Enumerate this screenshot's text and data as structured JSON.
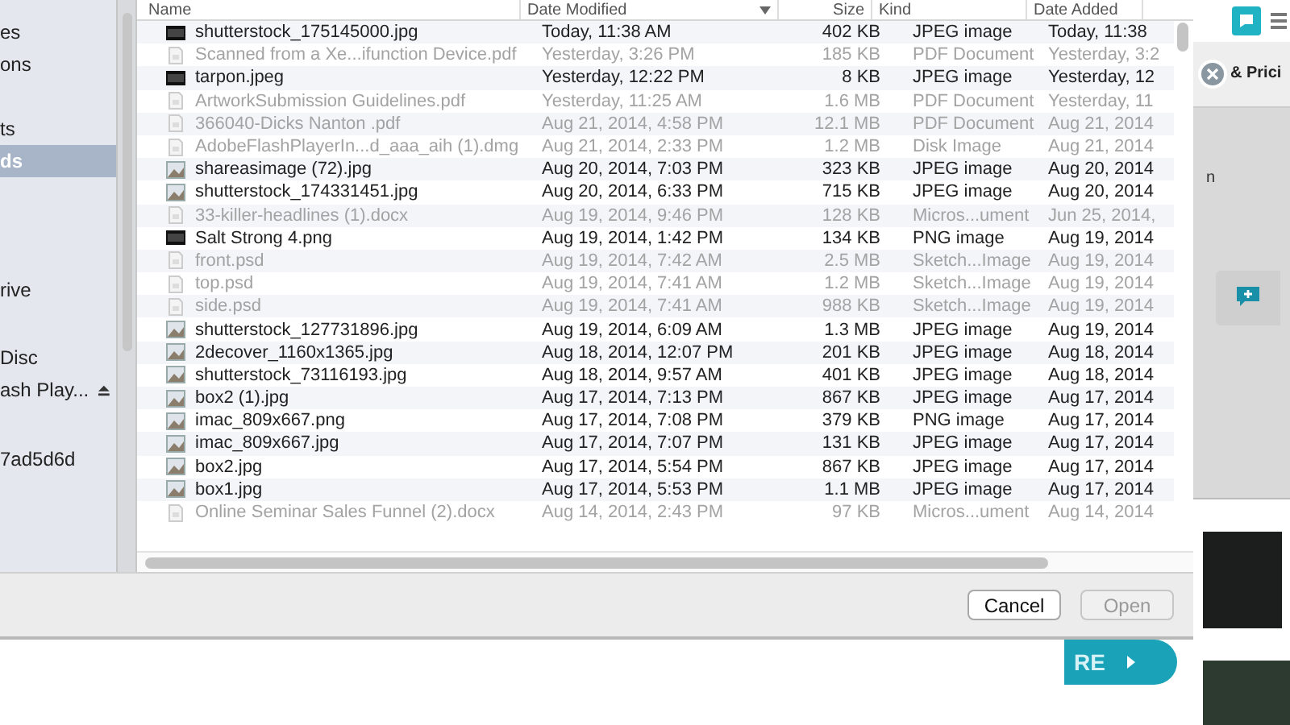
{
  "sidebar": {
    "groups": [
      {
        "items": [
          {
            "label": "es",
            "selected": false
          },
          {
            "label": "ons",
            "selected": false
          }
        ]
      },
      {
        "items": [
          {
            "label": "ts",
            "selected": false
          },
          {
            "label": "ds",
            "selected": true
          }
        ]
      },
      {
        "items": [
          {
            "label": "rive",
            "selected": false
          }
        ]
      },
      {
        "items": [
          {
            "label": "Disc",
            "selected": false
          },
          {
            "label": "ash Play...",
            "selected": false,
            "eject": true
          }
        ]
      },
      {
        "items": [
          {
            "label": "7ad5d6d",
            "selected": false
          }
        ]
      }
    ]
  },
  "file_list": {
    "columns": [
      {
        "label": "Name"
      },
      {
        "label": "Date Modified",
        "sorted": true
      },
      {
        "label": "Size"
      },
      {
        "label": "Kind"
      },
      {
        "label": "Date Added"
      }
    ],
    "rows": [
      {
        "kind": "screenshot",
        "name": "shutterstock_175145000.jpg",
        "modified": "Today, 11:38 AM",
        "size": "402 KB",
        "file_type": "JPEG image",
        "added": "Today, 11:38",
        "enabled": true
      },
      {
        "kind": "document",
        "name": "Scanned from a Xe...ifunction Device.pdf",
        "modified": "Yesterday, 3:26 PM",
        "size": "185 KB",
        "file_type": "PDF Document",
        "added": "Yesterday, 3:2",
        "enabled": false
      },
      {
        "kind": "screenshot",
        "name": "tarpon.jpeg",
        "modified": "Yesterday, 12:22 PM",
        "size": "8 KB",
        "file_type": "JPEG image",
        "added": "Yesterday, 12",
        "enabled": true
      },
      {
        "kind": "document",
        "name": "ArtworkSubmission Guidelines.pdf",
        "modified": "Yesterday, 11:25 AM",
        "size": "1.6 MB",
        "file_type": "PDF Document",
        "added": "Yesterday, 11",
        "enabled": false
      },
      {
        "kind": "document",
        "name": "366040-Dicks  Nanton .pdf",
        "modified": "Aug 21, 2014, 4:58 PM",
        "size": "12.1 MB",
        "file_type": "PDF Document",
        "added": "Aug 21, 2014",
        "enabled": false
      },
      {
        "kind": "document",
        "name": "AdobeFlashPlayerIn...d_aaa_aih (1).dmg",
        "modified": "Aug 21, 2014, 2:33 PM",
        "size": "1.2 MB",
        "file_type": "Disk Image",
        "added": "Aug 21, 2014",
        "enabled": false
      },
      {
        "kind": "photo",
        "name": "shareasimage (72).jpg",
        "modified": "Aug 20, 2014, 7:03 PM",
        "size": "323 KB",
        "file_type": "JPEG image",
        "added": "Aug 20, 2014",
        "enabled": true
      },
      {
        "kind": "photo",
        "name": "shutterstock_174331451.jpg",
        "modified": "Aug 20, 2014, 6:33 PM",
        "size": "715 KB",
        "file_type": "JPEG image",
        "added": "Aug 20, 2014",
        "enabled": true
      },
      {
        "kind": "document",
        "name": "33-killer-headlines (1).docx",
        "modified": "Aug 19, 2014, 9:46 PM",
        "size": "128 KB",
        "file_type": "Micros...ument",
        "added": "Jun 25, 2014,",
        "enabled": false
      },
      {
        "kind": "screenshot",
        "name": "Salt Strong 4.png",
        "modified": "Aug 19, 2014, 1:42 PM",
        "size": "134 KB",
        "file_type": "PNG image",
        "added": "Aug 19, 2014",
        "enabled": true
      },
      {
        "kind": "document",
        "name": "front.psd",
        "modified": "Aug 19, 2014, 7:42 AM",
        "size": "2.5 MB",
        "file_type": "Sketch...Image",
        "added": "Aug 19, 2014",
        "enabled": false
      },
      {
        "kind": "document",
        "name": "top.psd",
        "modified": "Aug 19, 2014, 7:41 AM",
        "size": "1.2 MB",
        "file_type": "Sketch...Image",
        "added": "Aug 19, 2014",
        "enabled": false
      },
      {
        "kind": "document",
        "name": "side.psd",
        "modified": "Aug 19, 2014, 7:41 AM",
        "size": "988 KB",
        "file_type": "Sketch...Image",
        "added": "Aug 19, 2014",
        "enabled": false
      },
      {
        "kind": "photo",
        "name": "shutterstock_127731896.jpg",
        "modified": "Aug 19, 2014, 6:09 AM",
        "size": "1.3 MB",
        "file_type": "JPEG image",
        "added": "Aug 19, 2014",
        "enabled": true
      },
      {
        "kind": "photo",
        "name": "2decover_1160x1365.jpg",
        "modified": "Aug 18, 2014, 12:07 PM",
        "size": "201 KB",
        "file_type": "JPEG image",
        "added": "Aug 18, 2014",
        "enabled": true
      },
      {
        "kind": "photo",
        "name": "shutterstock_73116193.jpg",
        "modified": "Aug 18, 2014, 9:57 AM",
        "size": "401 KB",
        "file_type": "JPEG image",
        "added": "Aug 18, 2014",
        "enabled": true
      },
      {
        "kind": "photo",
        "name": "box2 (1).jpg",
        "modified": "Aug 17, 2014, 7:13 PM",
        "size": "867 KB",
        "file_type": "JPEG image",
        "added": "Aug 17, 2014",
        "enabled": true
      },
      {
        "kind": "photo",
        "name": "imac_809x667.png",
        "modified": "Aug 17, 2014, 7:08 PM",
        "size": "379 KB",
        "file_type": "PNG image",
        "added": "Aug 17, 2014",
        "enabled": true
      },
      {
        "kind": "photo",
        "name": "imac_809x667.jpg",
        "modified": "Aug 17, 2014, 7:07 PM",
        "size": "131 KB",
        "file_type": "JPEG image",
        "added": "Aug 17, 2014",
        "enabled": true
      },
      {
        "kind": "photo",
        "name": "box2.jpg",
        "modified": "Aug 17, 2014, 5:54 PM",
        "size": "867 KB",
        "file_type": "JPEG image",
        "added": "Aug 17, 2014",
        "enabled": true
      },
      {
        "kind": "photo",
        "name": "box1.jpg",
        "modified": "Aug 17, 2014, 5:53 PM",
        "size": "1.1 MB",
        "file_type": "JPEG image",
        "added": "Aug 17, 2014",
        "enabled": true
      },
      {
        "kind": "document",
        "name": "Online Seminar Sales Funnel (2).docx",
        "modified": "Aug 14, 2014, 2:43 PM",
        "size": "97 KB",
        "file_type": "Micros...ument",
        "added": "Aug 14, 2014",
        "enabled": false
      }
    ]
  },
  "buttons": [
    {
      "label": "Cancel",
      "disabled": false
    },
    {
      "label": "Open",
      "disabled": true
    }
  ],
  "background_page": {
    "tab_label": "& Prici",
    "side_text": "n",
    "cta_label": "RE"
  }
}
